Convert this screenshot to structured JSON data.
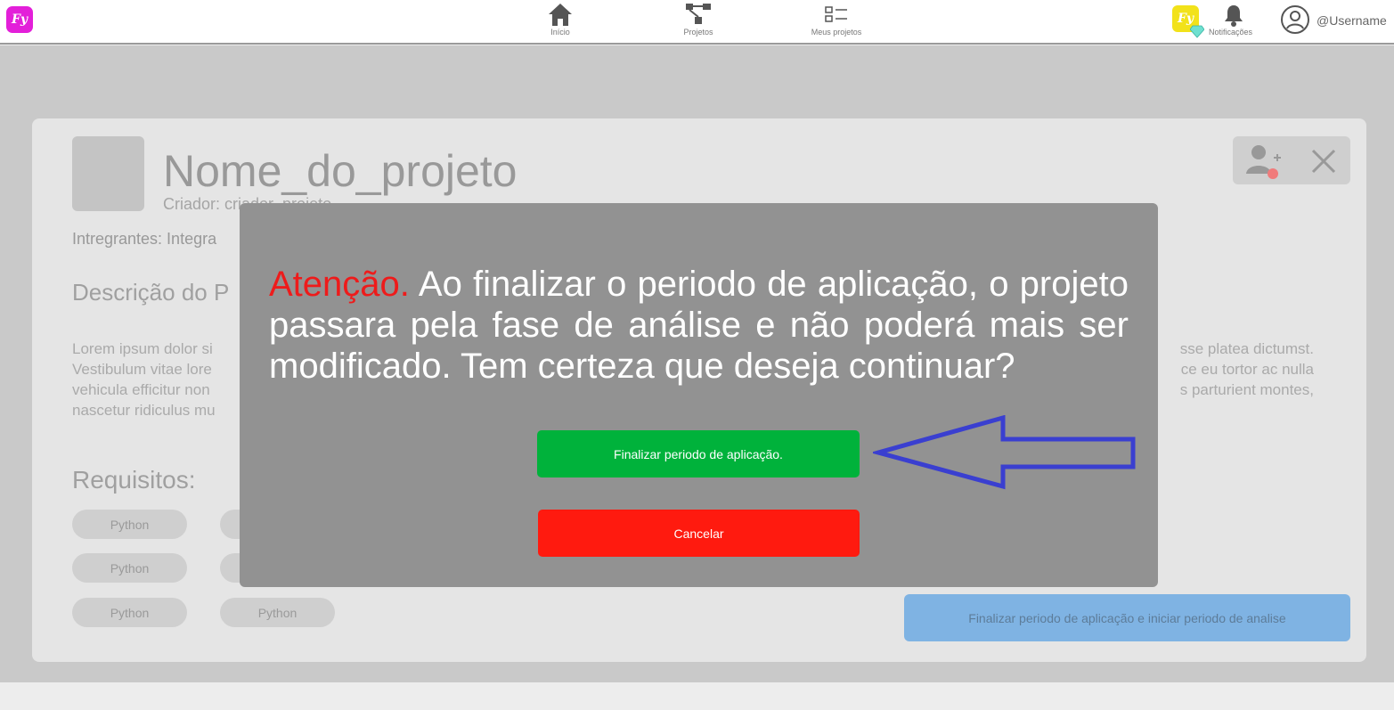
{
  "nav": {
    "logo_text": "Fy",
    "items": [
      {
        "label": "Início",
        "icon": "home-icon"
      },
      {
        "label": "Projetos",
        "icon": "projects-icon"
      },
      {
        "label": "Meus projetos",
        "icon": "list-icon"
      }
    ],
    "coin_text": "Fy",
    "notifications_label": "Notificações",
    "username": "@Username"
  },
  "project": {
    "name": "Nome_do_projeto",
    "creator": "Criador: criador_projeto",
    "members": "Intregrantes: Integra",
    "description_title": "Descrição do P",
    "lorem_lines": [
      "Lorem ipsum dolor si",
      "Vestibulum vitae lore",
      "vehicula efficitur non",
      "nascetur ridiculus mu"
    ],
    "lorem_right_lines": [
      "sse platea dictumst.",
      "ce eu tortor ac nulla",
      "s parturient montes,"
    ],
    "requirements_title": "Requisitos:",
    "requirements": [
      "Python",
      "Python",
      "Python",
      "Python"
    ],
    "finish_button": "Finalizar periodo de aplicação e iniciar periodo de analise"
  },
  "modal": {
    "warning_word": "Atenção.",
    "message": " Ao finalizar o periodo de aplicação, o projeto passara pela fase de análise e não poderá mais ser modificado. Tem certeza que deseja continuar?",
    "confirm_label": "Finalizar periodo de aplicação.",
    "cancel_label": "Cancelar"
  },
  "colors": {
    "logo": "#e31fd9",
    "confirm": "#00b23b",
    "cancel": "#ff1a0f",
    "warning": "#ee1b1b",
    "arrow": "#3a3fd0",
    "finish": "#7fb3e3"
  }
}
